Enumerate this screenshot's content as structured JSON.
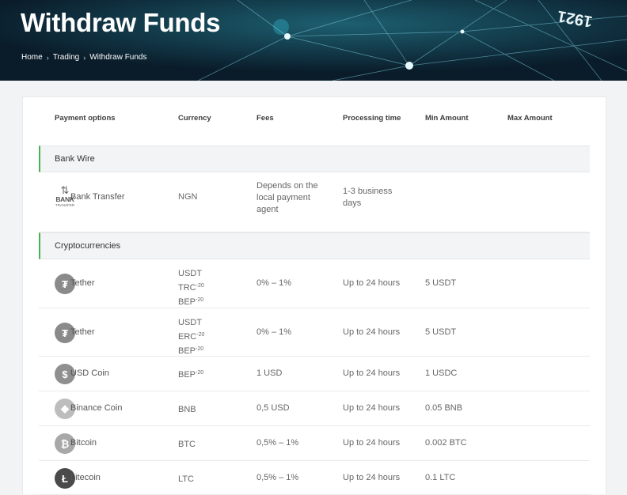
{
  "page": {
    "title": "Withdraw Funds",
    "breadcrumb": [
      {
        "label": "Home"
      },
      {
        "label": "Trading"
      },
      {
        "label": "Withdraw Funds"
      }
    ],
    "hero_tag": "1921"
  },
  "table": {
    "headers": {
      "payment": "Payment options",
      "currency": "Currency",
      "fees": "Fees",
      "processing": "Processing time",
      "min": "Min Amount",
      "max": "Max Amount"
    },
    "sections": [
      {
        "label": "Bank Wire"
      },
      {
        "label": "Cryptocurrencies"
      }
    ],
    "bank": {
      "icon": "bank-transfer-icon",
      "icon_text": "BANK",
      "icon_sub": "TRANSFER",
      "name": "Bank Transfer",
      "currency": "NGN",
      "fees": [
        "Depends on the",
        "local payment",
        "agent"
      ],
      "processing": [
        "1-3 business",
        "days"
      ]
    },
    "crypto": [
      {
        "icon": "tether-icon",
        "glyph": "₮",
        "name": "Tether",
        "currency": [
          "USDT",
          "TRC",
          "BEP"
        ],
        "sup": [
          "",
          "-20",
          "-20"
        ],
        "fees": "0% – 1%",
        "processing": "Up to 24 hours",
        "min": "5 USDT"
      },
      {
        "icon": "tether-icon",
        "glyph": "₮",
        "name": "Tether",
        "currency": [
          "USDT",
          "ERC",
          "BEP"
        ],
        "sup": [
          "",
          "-20",
          "-20"
        ],
        "fees": "0% – 1%",
        "processing": "Up to 24 hours",
        "min": "5 USDT"
      },
      {
        "icon": "usd-coin-icon",
        "glyph": "$",
        "name": "USD Coin",
        "currency": [
          "BEP"
        ],
        "sup": [
          "-20"
        ],
        "fees": "1 USD",
        "processing": "Up to 24 hours",
        "min": "1 USDC"
      },
      {
        "icon": "binance-coin-icon",
        "glyph": "◆",
        "name": "Binance Coin",
        "currency": [
          "BNB"
        ],
        "sup": [
          ""
        ],
        "fees": "0,5 USD",
        "processing": "Up to 24 hours",
        "min": "0.05 BNB"
      },
      {
        "icon": "bitcoin-icon",
        "glyph": "₿",
        "name": "Bitcoin",
        "currency": [
          "BTC"
        ],
        "sup": [
          ""
        ],
        "fees": "0,5% – 1%",
        "processing": "Up to 24 hours",
        "min": "0.002 BTC"
      },
      {
        "icon": "litecoin-icon",
        "glyph": "Ł",
        "name": "Litecoin",
        "currency": [
          "LTC"
        ],
        "sup": [
          ""
        ],
        "fees": "0,5% – 1%",
        "processing": "Up to 24 hours",
        "min": "0.1 LTC"
      }
    ]
  },
  "colors": {
    "accent": "#4caf50",
    "hero_bg": "#0b2233",
    "icon_grey": "#8a8a8a"
  }
}
